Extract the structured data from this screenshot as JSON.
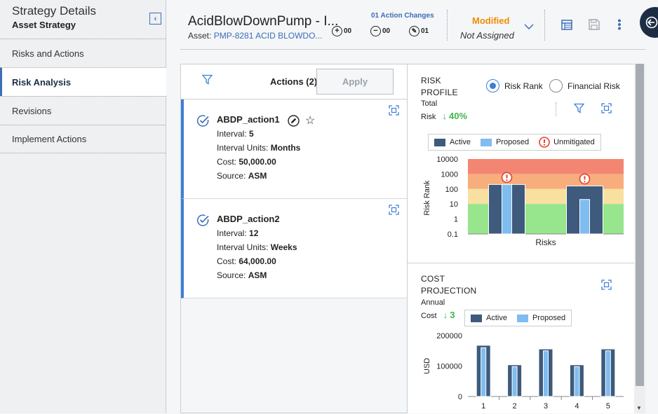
{
  "sidebar": {
    "title": "Strategy Details",
    "subtitle": "Asset Strategy",
    "items": [
      {
        "label": "Risks and Actions"
      },
      {
        "label": "Risk Analysis"
      },
      {
        "label": "Revisions"
      },
      {
        "label": "Implement Actions"
      }
    ],
    "active_index": 1
  },
  "header": {
    "title": "AcidBlowDownPump - I...",
    "asset_label": "Asset:",
    "asset_link": "PMP-8281 ACID BLOWDO...",
    "changes_label": "01 Action Changes",
    "added": "00",
    "removed": "00",
    "edited": "01",
    "status": "Modified",
    "assigned": "Not Assigned",
    "status_color": "#f08c00",
    "icons": [
      "table-icon",
      "save-icon",
      "more-vertical-icon",
      "exit-icon"
    ]
  },
  "actions": {
    "title": "Actions (2)",
    "apply_label": "Apply",
    "items": [
      {
        "name": "ABDP_action1",
        "interval_label": "Interval:",
        "interval": "5",
        "units_label": "Interval Units:",
        "units": "Months",
        "cost_label": "Cost:",
        "cost": "50,000.00",
        "source_label": "Source:",
        "source": "ASM"
      },
      {
        "name": "ABDP_action2",
        "interval_label": "Interval:",
        "interval": "12",
        "units_label": "Interval Units:",
        "units": "Weeks",
        "cost_label": "Cost:",
        "cost": "64,000.00",
        "source_label": "Source:",
        "source": "ASM"
      }
    ]
  },
  "risk_profile": {
    "title_line1": "RISK",
    "title_line2": "PROFILE",
    "total_label_1": "Total",
    "total_label_2": "Risk",
    "change": "40%",
    "radio_risk_rank": "Risk Rank",
    "radio_financial": "Financial Risk",
    "selected": "Risk Rank",
    "legend": [
      "Active",
      "Proposed",
      "Unmitigated"
    ]
  },
  "cost_projection": {
    "title_line1": "COST",
    "title_line2": "PROJECTION",
    "annual_label_1": "Annual",
    "annual_label_2": "Cost",
    "change": "3",
    "legend": [
      "Active",
      "Proposed"
    ]
  },
  "colors": {
    "active": "#3e5a7d",
    "proposed": "#7fbcf0",
    "accent": "#3d7fd6",
    "positive": "#3fb54b",
    "warning": "#e2442f"
  },
  "chart_data": [
    {
      "type": "bar",
      "xlabel": "Risks",
      "ylabel": "Risk Rank",
      "yscale": "log",
      "ylim": [
        0.1,
        10000
      ],
      "yticks": [
        "10000",
        "1000",
        "100",
        "10",
        "1",
        "0.1"
      ],
      "categories": [
        "",
        ""
      ],
      "series": [
        {
          "name": "Active",
          "values": [
            200,
            160
          ]
        },
        {
          "name": "Proposed",
          "values": [
            200,
            20
          ]
        }
      ],
      "unmitigated": [
        true,
        true
      ],
      "background_bands": [
        "red",
        "orange",
        "yellow",
        "green"
      ]
    },
    {
      "type": "bar",
      "xlabel": "",
      "ylabel": "USD",
      "ylim": [
        0,
        200000
      ],
      "yticks": [
        "200000",
        "100000",
        "0"
      ],
      "categories": [
        "1",
        "2",
        "3",
        "4",
        "5"
      ],
      "series": [
        {
          "name": "Active",
          "values": [
            168000,
            104000,
            156000,
            104000,
            156000
          ]
        },
        {
          "name": "Proposed",
          "values": [
            160000,
            98000,
            150000,
            98000,
            150000
          ]
        }
      ]
    }
  ]
}
